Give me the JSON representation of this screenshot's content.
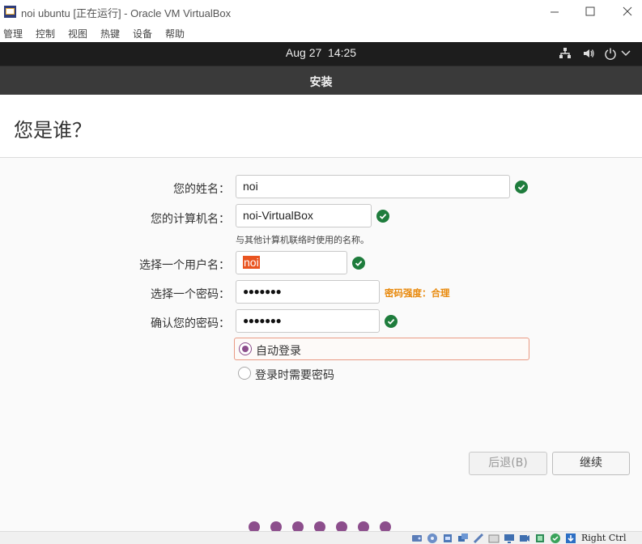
{
  "window": {
    "title": "noi ubuntu [正在运行] - Oracle VM VirtualBox"
  },
  "menubar": [
    "管理",
    "控制",
    "视图",
    "热键",
    "设备",
    "帮助"
  ],
  "topbar": {
    "date": "Aug 27",
    "time": "14:25"
  },
  "installer": {
    "title": "安装",
    "heading": "您是谁？"
  },
  "form": {
    "name": {
      "label": "您的姓名：",
      "value": "noi"
    },
    "computer": {
      "label": "您的计算机名：",
      "value": "noi-VirtualBox",
      "hint": "与其他计算机联络时使用的名称。"
    },
    "username": {
      "label": "选择一个用户名：",
      "value": "noi"
    },
    "password": {
      "label": "选择一个密码：",
      "value": "●●●●●●●",
      "strength": "密码强度：合理"
    },
    "confirm": {
      "label": "确认您的密码：",
      "value": "●●●●●●●"
    },
    "login_auto": "自动登录",
    "login_password": "登录时需要密码"
  },
  "buttons": {
    "back": "后退(B)",
    "next": "继续"
  },
  "status": {
    "hostkey": "Right Ctrl"
  },
  "colors": {
    "accent": "#8c4e8c",
    "check": "#1e7c3c",
    "warning": "#e8890c",
    "topbar": "#1d1d1d",
    "header": "#3a3a3a"
  }
}
